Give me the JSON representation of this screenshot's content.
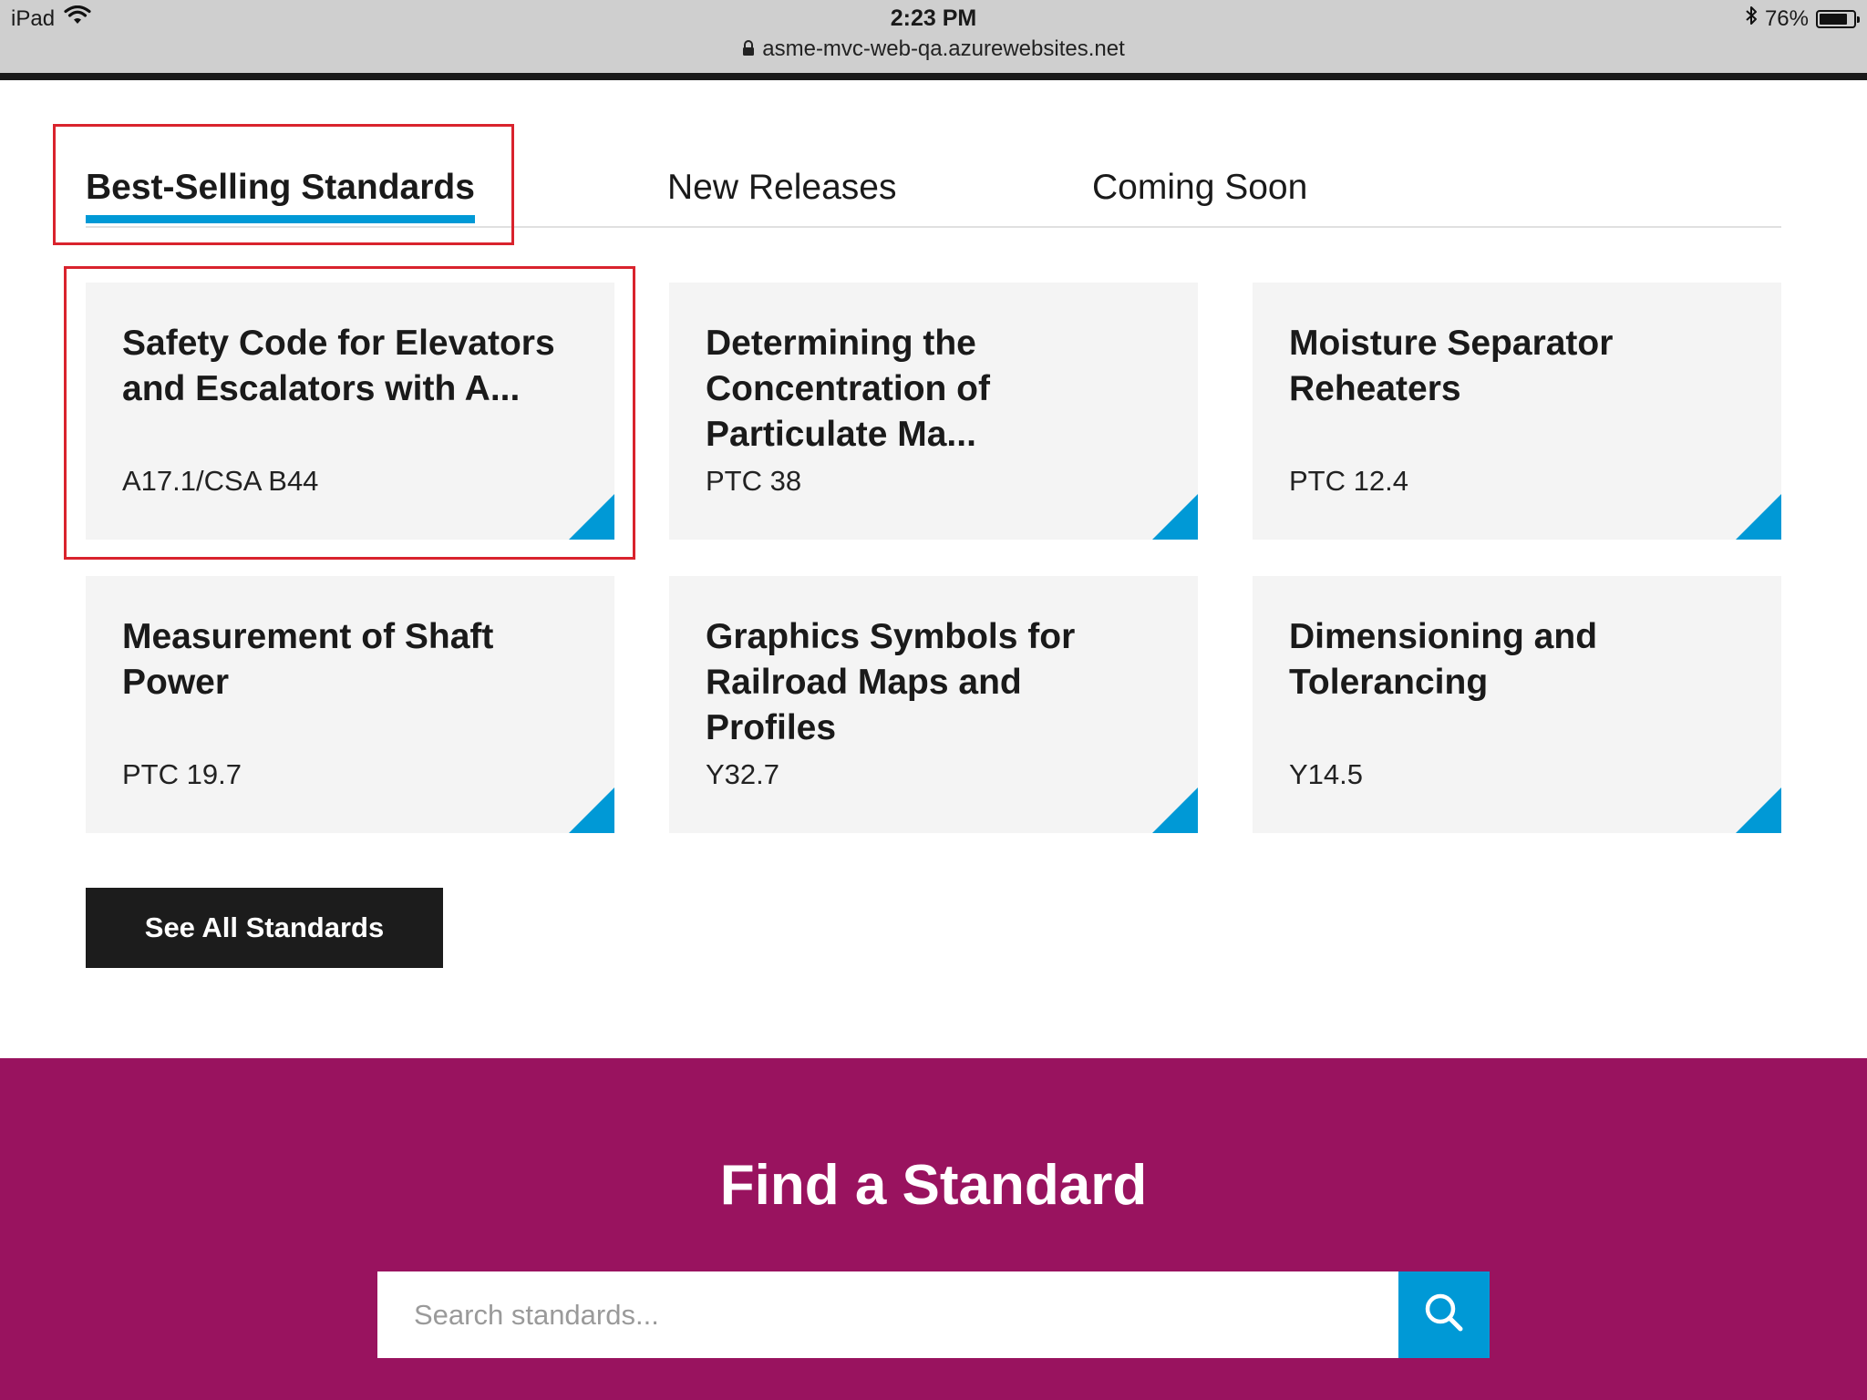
{
  "status_bar": {
    "device": "iPad",
    "time": "2:23 PM",
    "url": "asme-mvc-web-qa.azurewebsites.net",
    "battery": "76%",
    "battery_level": 0.76,
    "icons": [
      "wifi-icon",
      "lock-icon",
      "bluetooth-icon",
      "battery-icon"
    ]
  },
  "tabs": [
    {
      "label": "Best-Selling Standards",
      "active": true
    },
    {
      "label": "New Releases",
      "active": false
    },
    {
      "label": "Coming Soon",
      "active": false
    }
  ],
  "cards": [
    {
      "title": "Safety Code for Elevators and Escalators with A...",
      "code": "A17.1/CSA B44"
    },
    {
      "title": "Determining the Concentration of Particulate Ma...",
      "code": "PTC 38"
    },
    {
      "title": "Moisture Separator Reheaters",
      "code": "PTC 12.4"
    },
    {
      "title": "Measurement of Shaft Power",
      "code": "PTC 19.7"
    },
    {
      "title": "Graphics Symbols for Railroad Maps and Profiles",
      "code": "Y32.7"
    },
    {
      "title": "Dimensioning and Tolerancing",
      "code": "Y14.5"
    }
  ],
  "see_all_label": "See All Standards",
  "find": {
    "title": "Find a Standard",
    "placeholder": "Search standards..."
  },
  "colors": {
    "accent_blue": "#0099d6",
    "find_background": "#99135f",
    "highlight_red": "#d9232d",
    "button_dark": "#1c1c1c"
  }
}
